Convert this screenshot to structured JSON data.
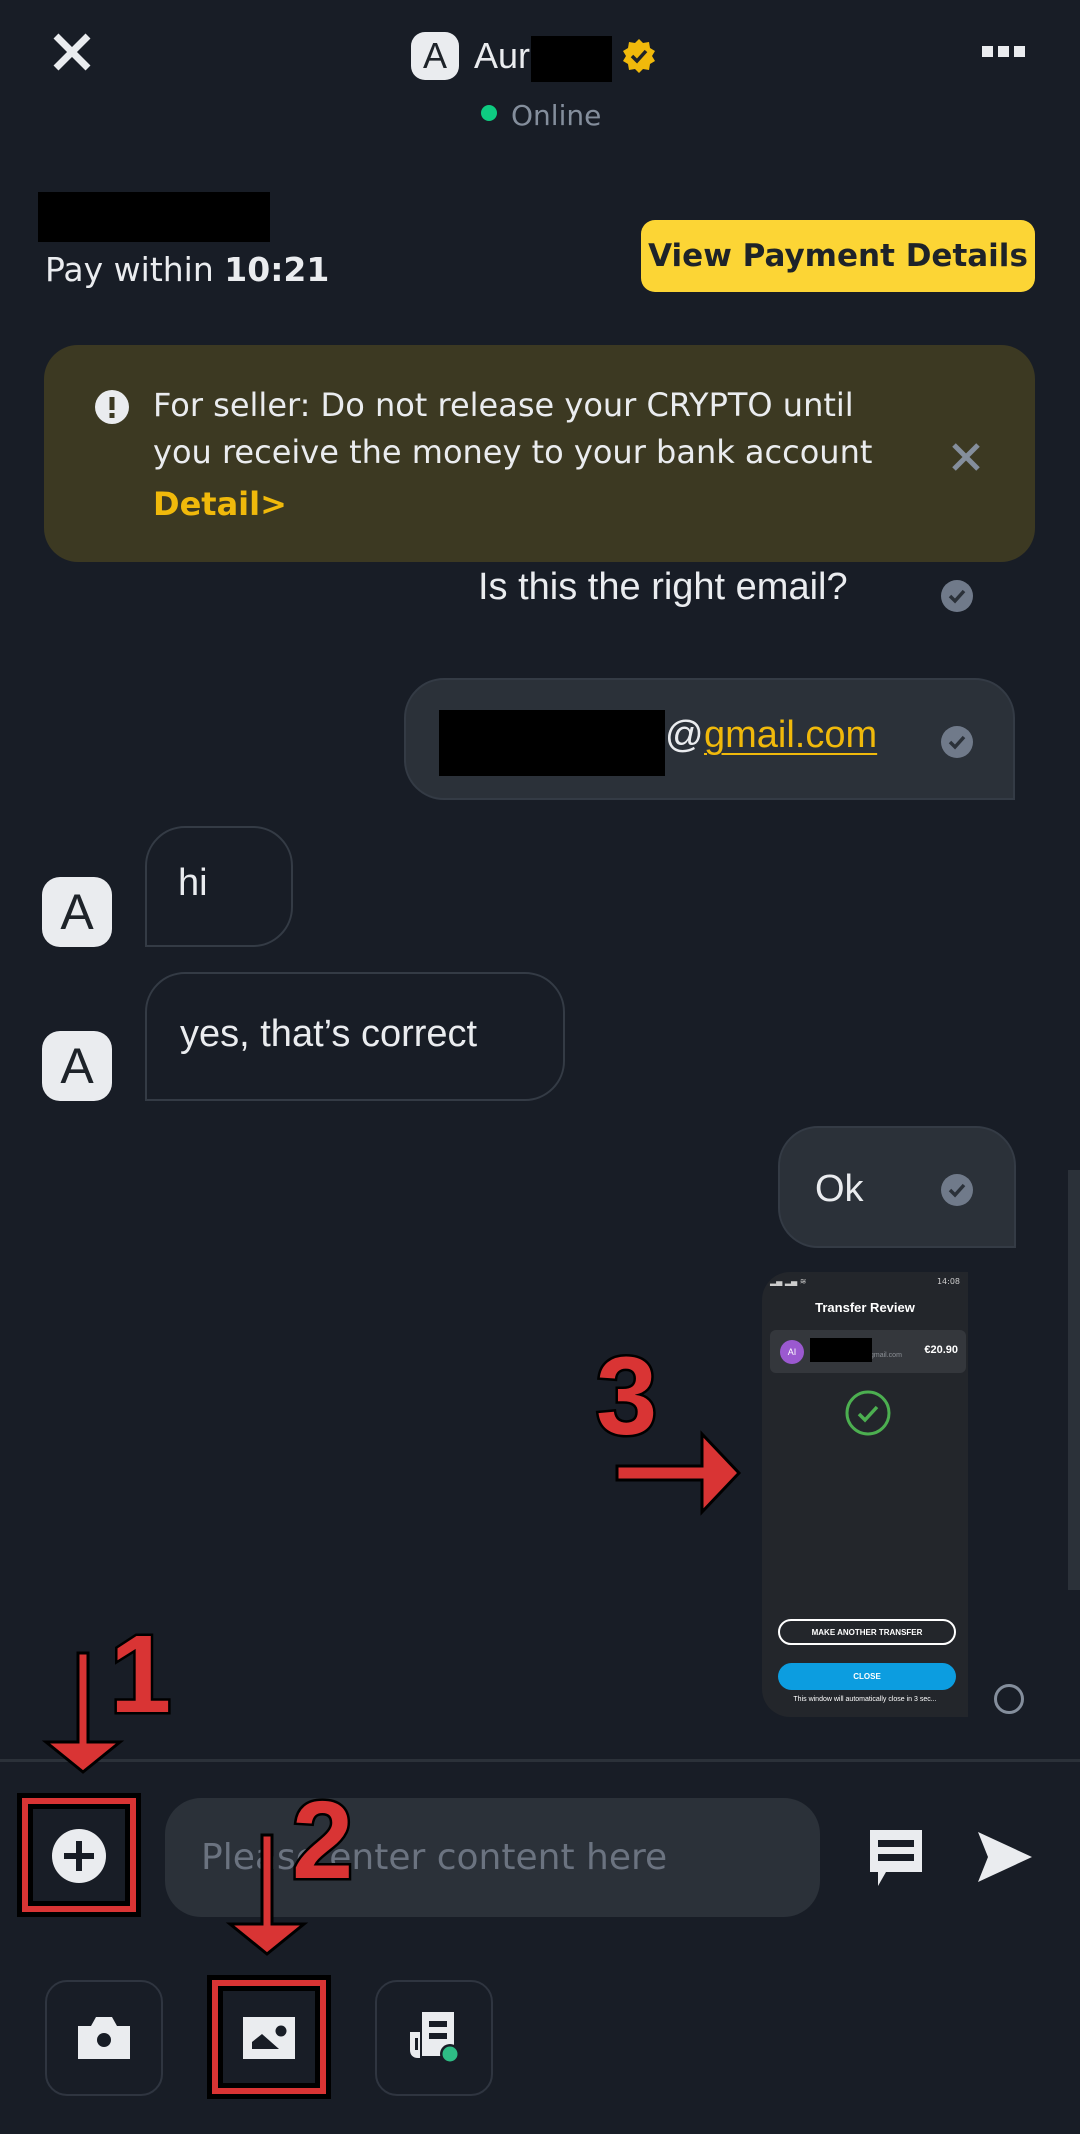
{
  "header": {
    "avatar_letter": "A",
    "name_visible": "Aur",
    "name_redacted": true,
    "verified": true,
    "status": "Online",
    "status_color": "#0ecb81",
    "close_icon": "close-icon",
    "more_icon": "more-icon"
  },
  "order": {
    "pay_within_label": "Pay within",
    "countdown": "10:21",
    "view_payment_button": "View Payment Details",
    "accent_color": "#fcd535"
  },
  "warning": {
    "text": "For seller: Do not release your CRYPTO until you receive the money to your bank account",
    "detail_link": "Detail>"
  },
  "messages": [
    {
      "direction": "out",
      "text": "Is this the right email?",
      "status": "read"
    },
    {
      "direction": "out",
      "text_redacted_prefix": true,
      "at": "@",
      "link": "gmail.com",
      "status": "read"
    },
    {
      "direction": "in",
      "avatar": "A",
      "text": "hi"
    },
    {
      "direction": "in",
      "avatar": "A",
      "text": "yes, that’s correct"
    },
    {
      "direction": "out",
      "text": "Ok",
      "status": "read"
    },
    {
      "direction": "out",
      "type": "image",
      "status": "sending",
      "image": {
        "status_time": "14:08",
        "title": "Transfer Review",
        "recipient_initials": "AI",
        "recipient_email_suffix": "gmail.com",
        "amount": "€20.90",
        "button_primary_outline": "MAKE ANOTHER TRANSFER",
        "button_close": "CLOSE",
        "footnote": "This window will automatically close in 3 sec..."
      }
    }
  ],
  "composer": {
    "placeholder": "Please enter content here",
    "value": "",
    "plus_icon": "plus-circle-icon",
    "quick_reply_icon": "chat-icon",
    "send_icon": "send-icon"
  },
  "actions": [
    {
      "name": "camera",
      "icon": "camera-icon"
    },
    {
      "name": "image",
      "icon": "image-icon"
    },
    {
      "name": "file",
      "icon": "file-icon"
    }
  ],
  "annotations": {
    "numbers": [
      "1",
      "2",
      "3"
    ],
    "color": "#d93434"
  }
}
